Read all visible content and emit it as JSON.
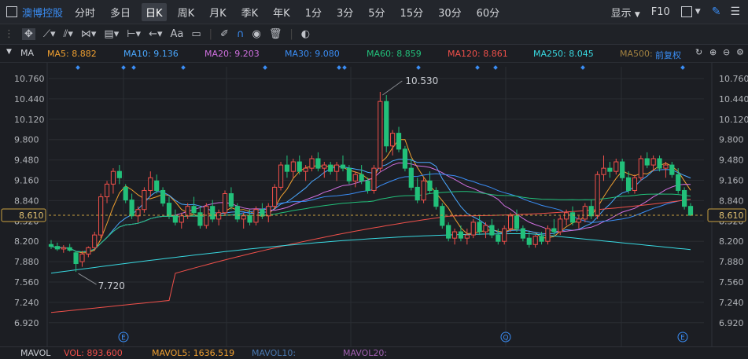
{
  "toolbar": {
    "stock_name": "澳博控股",
    "timeframes": [
      "分时",
      "多日",
      "日K",
      "周K",
      "月K",
      "季K",
      "年K",
      "1分",
      "3分",
      "5分",
      "15分",
      "30分",
      "60分"
    ],
    "active_timeframe": "日K",
    "display_label": "显示",
    "f10_label": "F10"
  },
  "drawing_tools": {
    "text_tool": "Aa"
  },
  "ma_legend": {
    "label": "MA",
    "items": [
      {
        "text": "MA5: 8.882",
        "color": "#f0a030"
      },
      {
        "text": "MA10: 9.136",
        "color": "#4aa8ff"
      },
      {
        "text": "MA20: 9.203",
        "color": "#d070e0"
      },
      {
        "text": "MA30: 9.080",
        "color": "#3a8df5"
      },
      {
        "text": "MA60: 8.859",
        "color": "#22c07a"
      },
      {
        "text": "MA120: 8.861",
        "color": "#f0504a"
      },
      {
        "text": "MA250: 8.045",
        "color": "#38d8e0"
      },
      {
        "text": "MA500:",
        "color": "#a08040"
      }
    ],
    "adjust_label": "前复权"
  },
  "chart_data": {
    "type": "candlestick",
    "y_ticks": [
      "10.760",
      "10.440",
      "10.120",
      "9.800",
      "9.480",
      "9.160",
      "8.840",
      "8.520",
      "8.200",
      "7.880",
      "7.560",
      "7.240",
      "6.920"
    ],
    "ylim": [
      6.92,
      10.76
    ],
    "current_price": "8.610",
    "annotations": {
      "high": "10.530",
      "low": "7.720"
    },
    "event_markers": [
      "E",
      "Q",
      "E"
    ],
    "series": [
      {
        "name": "MA5",
        "color": "#f0a030"
      },
      {
        "name": "MA10",
        "color": "#4aa8ff"
      },
      {
        "name": "MA20",
        "color": "#d070e0"
      },
      {
        "name": "MA30",
        "color": "#3a8df5"
      },
      {
        "name": "MA60",
        "color": "#22c07a"
      },
      {
        "name": "MA120",
        "color": "#f0504a"
      },
      {
        "name": "MA250",
        "color": "#38d8e0"
      }
    ],
    "candles_ohlc": [
      [
        8.15,
        8.22,
        8.08,
        8.12
      ],
      [
        8.12,
        8.18,
        8.05,
        8.08
      ],
      [
        8.08,
        8.14,
        8.02,
        8.1
      ],
      [
        8.1,
        8.16,
        8.04,
        8.06
      ],
      [
        8.02,
        8.05,
        7.72,
        7.85
      ],
      [
        7.88,
        8.05,
        7.8,
        8.0
      ],
      [
        8.0,
        8.12,
        7.95,
        8.1
      ],
      [
        8.1,
        8.35,
        8.05,
        8.3
      ],
      [
        8.3,
        8.95,
        8.25,
        8.9
      ],
      [
        8.9,
        9.15,
        8.8,
        9.1
      ],
      [
        9.1,
        9.35,
        8.95,
        9.3
      ],
      [
        9.3,
        9.4,
        9.1,
        9.2
      ],
      [
        9.05,
        9.1,
        8.8,
        8.85
      ],
      [
        8.85,
        8.95,
        8.55,
        8.6
      ],
      [
        8.6,
        8.75,
        8.5,
        8.7
      ],
      [
        8.7,
        9.05,
        8.65,
        9.0
      ],
      [
        9.0,
        9.3,
        8.9,
        9.2
      ],
      [
        9.15,
        9.25,
        8.95,
        9.0
      ],
      [
        9.0,
        9.05,
        8.75,
        8.8
      ],
      [
        8.8,
        8.9,
        8.55,
        8.6
      ],
      [
        8.6,
        8.7,
        8.45,
        8.5
      ],
      [
        8.5,
        8.65,
        8.4,
        8.6
      ],
      [
        8.6,
        8.8,
        8.55,
        8.75
      ],
      [
        8.75,
        8.9,
        8.6,
        8.65
      ],
      [
        8.65,
        8.75,
        8.4,
        8.45
      ],
      [
        8.45,
        8.8,
        8.4,
        8.75
      ],
      [
        8.75,
        8.85,
        8.5,
        8.55
      ],
      [
        8.55,
        8.7,
        8.45,
        8.65
      ],
      [
        8.65,
        9.0,
        8.6,
        8.95
      ],
      [
        8.95,
        9.05,
        8.7,
        8.75
      ],
      [
        8.75,
        8.8,
        8.5,
        8.55
      ],
      [
        8.55,
        8.65,
        8.4,
        8.6
      ],
      [
        8.6,
        8.7,
        8.45,
        8.5
      ],
      [
        8.5,
        8.75,
        8.45,
        8.7
      ],
      [
        8.7,
        8.8,
        8.55,
        8.6
      ],
      [
        8.6,
        8.8,
        8.5,
        8.75
      ],
      [
        8.75,
        9.1,
        8.7,
        9.05
      ],
      [
        9.05,
        9.45,
        9.0,
        9.4
      ],
      [
        9.4,
        9.55,
        9.2,
        9.3
      ],
      [
        9.3,
        9.5,
        9.2,
        9.45
      ],
      [
        9.45,
        9.55,
        9.25,
        9.3
      ],
      [
        9.3,
        9.4,
        9.15,
        9.35
      ],
      [
        9.35,
        9.55,
        9.3,
        9.5
      ],
      [
        9.5,
        9.6,
        9.3,
        9.35
      ],
      [
        9.35,
        9.45,
        9.2,
        9.4
      ],
      [
        9.4,
        9.45,
        9.25,
        9.3
      ],
      [
        9.3,
        9.45,
        9.15,
        9.4
      ],
      [
        9.4,
        9.55,
        9.3,
        9.35
      ],
      [
        9.35,
        9.4,
        9.1,
        9.15
      ],
      [
        9.15,
        9.3,
        9.05,
        9.25
      ],
      [
        9.25,
        9.4,
        9.1,
        9.15
      ],
      [
        9.15,
        9.2,
        8.95,
        9.0
      ],
      [
        9.0,
        9.4,
        8.95,
        9.35
      ],
      [
        9.35,
        10.55,
        9.3,
        10.4
      ],
      [
        10.4,
        10.5,
        9.6,
        9.7
      ],
      [
        9.7,
        9.95,
        9.55,
        9.9
      ],
      [
        9.9,
        10.0,
        9.6,
        9.65
      ],
      [
        9.65,
        9.7,
        9.3,
        9.35
      ],
      [
        9.35,
        9.5,
        9.0,
        9.05
      ],
      [
        9.05,
        9.2,
        8.8,
        8.85
      ],
      [
        8.85,
        9.2,
        8.8,
        9.15
      ],
      [
        9.15,
        9.3,
        8.95,
        9.0
      ],
      [
        9.0,
        9.05,
        8.7,
        8.75
      ],
      [
        8.75,
        8.8,
        8.4,
        8.45
      ],
      [
        8.45,
        8.5,
        8.2,
        8.25
      ],
      [
        8.25,
        8.4,
        8.15,
        8.35
      ],
      [
        8.35,
        8.45,
        8.2,
        8.25
      ],
      [
        8.25,
        8.4,
        8.15,
        8.3
      ],
      [
        8.3,
        8.55,
        8.25,
        8.5
      ],
      [
        8.5,
        8.6,
        8.3,
        8.35
      ],
      [
        8.35,
        8.5,
        8.25,
        8.45
      ],
      [
        8.45,
        8.55,
        8.25,
        8.3
      ],
      [
        8.3,
        8.4,
        8.15,
        8.2
      ],
      [
        8.2,
        8.45,
        8.15,
        8.4
      ],
      [
        8.4,
        8.65,
        8.35,
        8.6
      ],
      [
        8.6,
        8.7,
        8.35,
        8.4
      ],
      [
        8.4,
        8.45,
        8.2,
        8.25
      ],
      [
        8.25,
        8.35,
        8.1,
        8.15
      ],
      [
        8.15,
        8.3,
        8.1,
        8.28
      ],
      [
        8.28,
        8.35,
        8.15,
        8.2
      ],
      [
        8.2,
        8.45,
        8.15,
        8.4
      ],
      [
        8.4,
        8.55,
        8.3,
        8.35
      ],
      [
        8.35,
        8.6,
        8.3,
        8.55
      ],
      [
        8.55,
        8.7,
        8.45,
        8.65
      ],
      [
        8.65,
        8.75,
        8.45,
        8.5
      ],
      [
        8.5,
        8.6,
        8.4,
        8.55
      ],
      [
        8.55,
        8.8,
        8.5,
        8.75
      ],
      [
        8.75,
        8.85,
        8.55,
        8.6
      ],
      [
        8.6,
        9.3,
        8.55,
        9.25
      ],
      [
        9.25,
        9.55,
        9.15,
        9.35
      ],
      [
        9.35,
        9.45,
        9.2,
        9.3
      ],
      [
        9.3,
        9.5,
        9.25,
        9.45
      ],
      [
        9.45,
        9.5,
        9.15,
        9.2
      ],
      [
        9.2,
        9.3,
        8.95,
        9.0
      ],
      [
        9.0,
        9.25,
        8.95,
        9.2
      ],
      [
        9.2,
        9.55,
        9.15,
        9.5
      ],
      [
        9.5,
        9.6,
        9.35,
        9.4
      ],
      [
        9.4,
        9.55,
        9.3,
        9.5
      ],
      [
        9.5,
        9.55,
        9.3,
        9.35
      ],
      [
        9.35,
        9.45,
        9.2,
        9.4
      ],
      [
        9.4,
        9.45,
        9.2,
        9.25
      ],
      [
        9.25,
        9.35,
        8.95,
        9.0
      ],
      [
        9.0,
        9.05,
        8.7,
        8.75
      ],
      [
        8.75,
        8.8,
        8.6,
        8.61
      ]
    ]
  },
  "volume": {
    "label": "MAVOL",
    "vol": "VOL: 893.600",
    "mavol5": "MAVOL5: 1636.519",
    "mavol10": "MAVOL10:",
    "mavol20": "MAVOL20:"
  }
}
